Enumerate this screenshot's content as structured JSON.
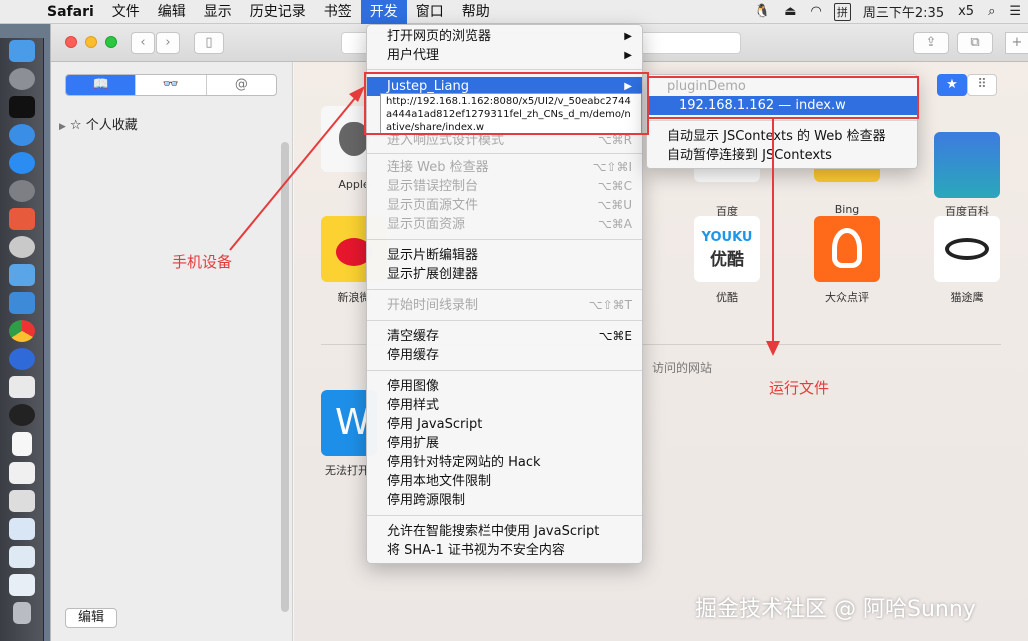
{
  "menubar": {
    "apple_icon": "apple-icon",
    "app_name": "Safari",
    "items": [
      "文件",
      "编辑",
      "显示",
      "历史记录",
      "书签",
      "开发",
      "窗口",
      "帮助"
    ],
    "active_item": "开发",
    "right": {
      "datetime": "周三下午2:35",
      "extra": "x5",
      "input_method": "拼"
    }
  },
  "sidebar": {
    "tabs": [
      "📖",
      "👓",
      "@"
    ],
    "favorites_label": "个人收藏",
    "edit_button": "编辑"
  },
  "content": {
    "tiles_row1": [
      "Apple",
      "百度",
      "Bing",
      "百度百科"
    ],
    "tiles_row2": [
      "新浪微",
      "优酷",
      "大众点评",
      "猫途鹰"
    ],
    "youku_logo": "YOUKU",
    "youku_logo_sub": "优酷",
    "frequent_label": "访问的网站",
    "row3_label": "无法打开"
  },
  "develop_menu": {
    "items": [
      {
        "label": "打开网页的浏览器",
        "shortcut": "",
        "submenu": true,
        "disabled": false
      },
      {
        "label": "用户代理",
        "shortcut": "",
        "submenu": true,
        "disabled": false
      },
      {
        "label": "Justep_Liang",
        "shortcut": "",
        "submenu": true,
        "disabled": false,
        "highlighted": true
      },
      {
        "label": "进入响应式设计模式",
        "shortcut": "⌥⌘R",
        "disabled": true
      },
      {
        "label": "连接 Web 检查器",
        "shortcut": "⌥⇧⌘I",
        "disabled": true
      },
      {
        "label": "显示错误控制台",
        "shortcut": "⌥⌘C",
        "disabled": true
      },
      {
        "label": "显示页面源文件",
        "shortcut": "⌥⌘U",
        "disabled": true
      },
      {
        "label": "显示页面资源",
        "shortcut": "⌥⌘A",
        "disabled": true
      },
      {
        "label": "显示片断编辑器",
        "shortcut": "",
        "disabled": false
      },
      {
        "label": "显示扩展创建器",
        "shortcut": "",
        "disabled": false
      },
      {
        "label": "开始时间线录制",
        "shortcut": "⌥⇧⌘T",
        "disabled": true
      },
      {
        "label": "清空缓存",
        "shortcut": "⌥⌘E",
        "disabled": false
      },
      {
        "label": "停用缓存",
        "shortcut": "",
        "disabled": false
      },
      {
        "label": "停用图像",
        "shortcut": "",
        "disabled": false
      },
      {
        "label": "停用样式",
        "shortcut": "",
        "disabled": false
      },
      {
        "label": "停用 JavaScript",
        "shortcut": "",
        "disabled": false
      },
      {
        "label": "停用扩展",
        "shortcut": "",
        "disabled": false
      },
      {
        "label": "停用针对特定网站的 Hack",
        "shortcut": "",
        "disabled": false
      },
      {
        "label": "停用本地文件限制",
        "shortcut": "",
        "disabled": false
      },
      {
        "label": "停用跨源限制",
        "shortcut": "",
        "disabled": false
      },
      {
        "label": "允许在智能搜索栏中使用 JavaScript",
        "shortcut": "",
        "disabled": false
      },
      {
        "label": "将 SHA-1 证书视为不安全内容",
        "shortcut": "",
        "disabled": false
      }
    ],
    "tooltip": "http://192.168.1.162:8080/x5/UI2/v_50eabc2744a444a1ad812ef1279311fel_zh_CNs_d_m/demo/native/share/index.w"
  },
  "submenu": {
    "header": "pluginDemo",
    "selected": "192.168.1.162 — index.w",
    "items": [
      "自动显示 JSContexts 的 Web 检查器",
      "自动暂停连接到 JSContexts"
    ]
  },
  "annotations": {
    "device_label": "手机设备",
    "file_label": "运行文件",
    "color": "#e53b3b"
  },
  "watermark": "掘金技术社区 @ 阿哈Sunny"
}
